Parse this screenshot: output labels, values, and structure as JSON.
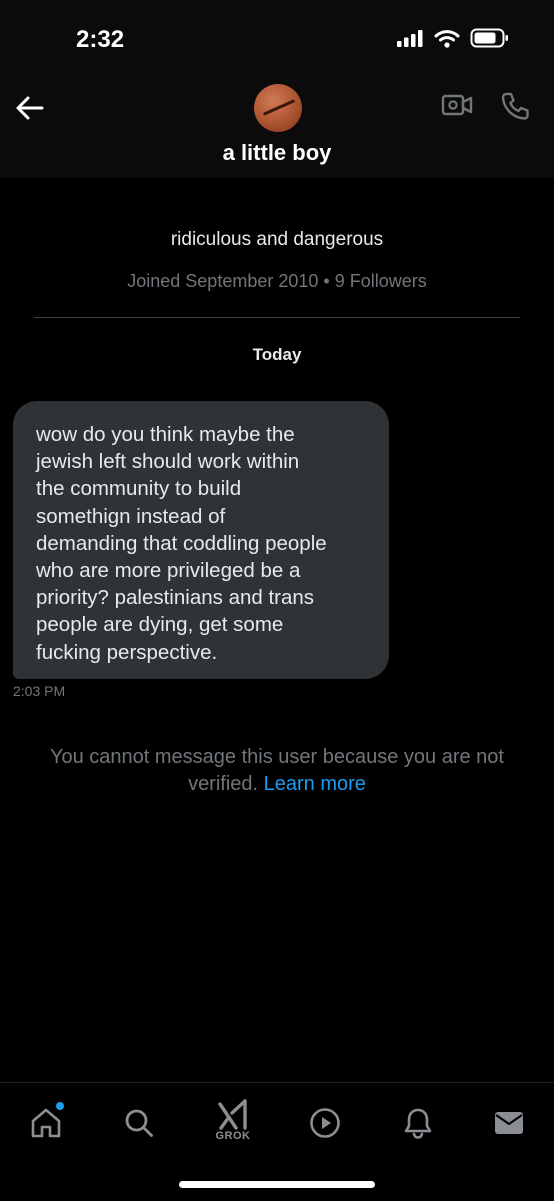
{
  "status_bar": {
    "time": "2:32"
  },
  "header": {
    "contact_name": "a little boy"
  },
  "profile": {
    "bio": "ridiculous and dangerous",
    "meta": "Joined September 2010 • 9 Followers"
  },
  "conversation": {
    "day_label": "Today",
    "messages": [
      {
        "text": "wow do you think maybe the\njewish left should work within\nthe community to build\nsomethign instead of\ndemanding that coddling people\nwho are more privileged  be a\npriority? palestinians and trans\npeople are dying, get some\nfucking perspective.",
        "time": "2:03 PM"
      }
    ]
  },
  "notice": {
    "text": "You cannot message this user because you are not verified.",
    "link": "Learn more"
  },
  "tabbar": {
    "grok_label": "GROK",
    "accent_color": "#1d9bf0"
  },
  "icons": [
    "back-arrow-icon",
    "video-call-icon",
    "phone-icon",
    "home-icon",
    "search-icon",
    "grok-icon",
    "play-icon",
    "bell-icon",
    "mail-icon",
    "signal-icon",
    "wifi-icon",
    "battery-icon"
  ]
}
